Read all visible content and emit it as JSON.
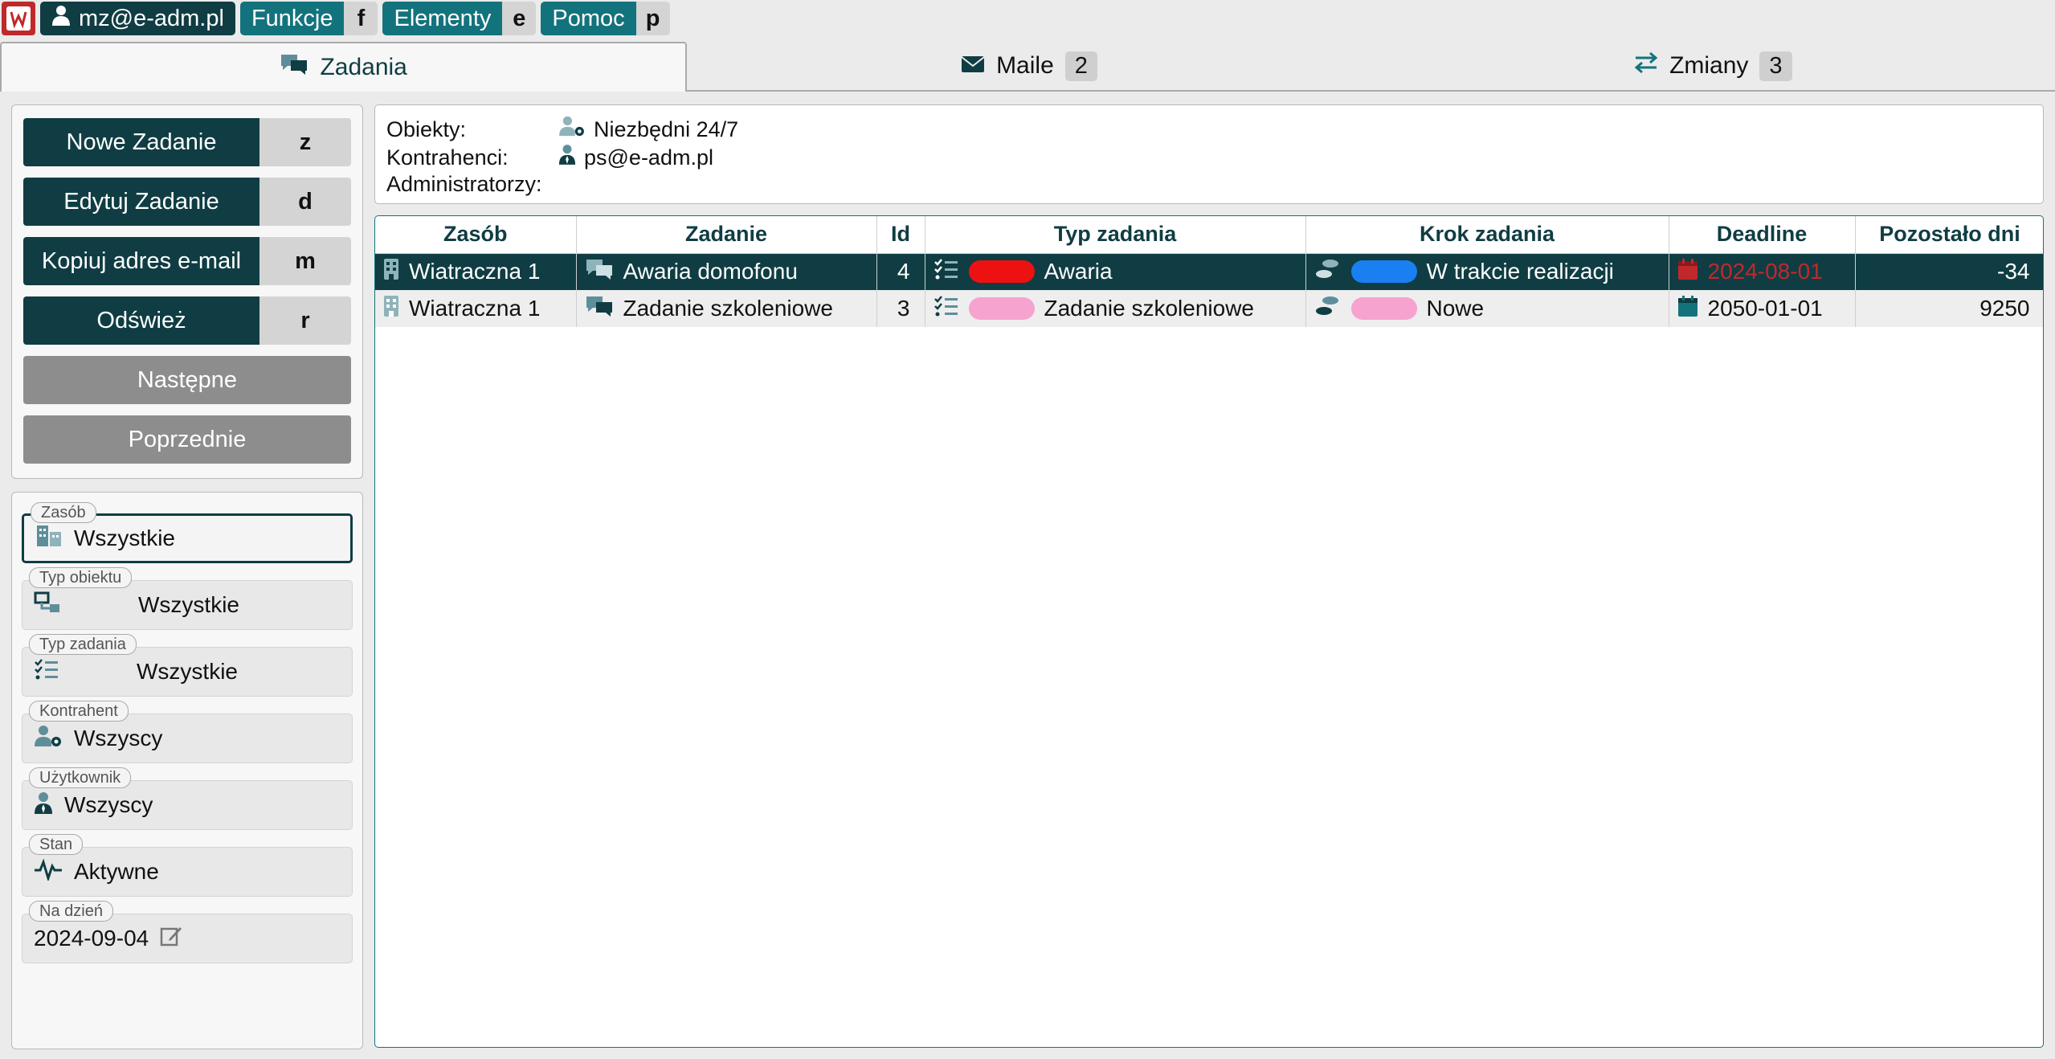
{
  "topbar": {
    "user": "mz@e-adm.pl",
    "menus": [
      {
        "label": "Funkcje",
        "key": "f"
      },
      {
        "label": "Elementy",
        "key": "e"
      },
      {
        "label": "Pomoc",
        "key": "p"
      }
    ]
  },
  "tabs": [
    {
      "label": "Zadania",
      "badge": ""
    },
    {
      "label": "Maile",
      "badge": "2"
    },
    {
      "label": "Zmiany",
      "badge": "3"
    }
  ],
  "actions": [
    {
      "label": "Nowe Zadanie",
      "key": "z"
    },
    {
      "label": "Edytuj Zadanie",
      "key": "d"
    },
    {
      "label": "Kopiuj adres e-mail",
      "key": "m"
    },
    {
      "label": "Odśwież",
      "key": "r"
    },
    {
      "label": "Następne"
    },
    {
      "label": "Poprzednie"
    }
  ],
  "filters": {
    "zasob": {
      "legend": "Zasób",
      "value": "Wszystkie"
    },
    "typ_obiektu": {
      "legend": "Typ obiektu",
      "value": "Wszystkie"
    },
    "typ_zadania": {
      "legend": "Typ zadania",
      "value": "Wszystkie"
    },
    "kontrahent": {
      "legend": "Kontrahent",
      "value": "Wszyscy"
    },
    "uzytkownik": {
      "legend": "Użytkownik",
      "value": "Wszyscy"
    },
    "stan": {
      "legend": "Stan",
      "value": "Aktywne"
    },
    "na_dzien": {
      "legend": "Na dzień",
      "value": "2024-09-04"
    }
  },
  "info": {
    "obiekty_label": "Obiekty:",
    "obiekty_value": "Niezbędni 24/7",
    "kontrahenci_label": "Kontrahenci:",
    "kontrahenci_value": "ps@e-adm.pl",
    "administratorzy_label": "Administratorzy:"
  },
  "table": {
    "columns": [
      "Zasób",
      "Zadanie",
      "Id",
      "Typ zadania",
      "Krok zadania",
      "Deadline",
      "Pozostało dni"
    ],
    "rows": [
      {
        "zasob": "Wiatraczna 1",
        "zadanie": "Awaria domofonu",
        "id": "4",
        "typ": "Awaria",
        "typ_color": "#ee1111",
        "krok": "W trakcie realizacji",
        "krok_color": "#1a7ff0",
        "deadline": "2024-08-01",
        "pozostalo": "-34",
        "selected": true
      },
      {
        "zasob": "Wiatraczna 1",
        "zadanie": "Zadanie szkoleniowe",
        "id": "3",
        "typ": "Zadanie szkoleniowe",
        "typ_color": "#f6a3cf",
        "krok": "Nowe",
        "krok_color": "#f6a3cf",
        "deadline": "2050-01-01",
        "pozostalo": "9250",
        "selected": false
      }
    ]
  },
  "colors": {
    "primary": "#0f3d43",
    "accent": "#13737d",
    "alert": "#c0292b"
  }
}
